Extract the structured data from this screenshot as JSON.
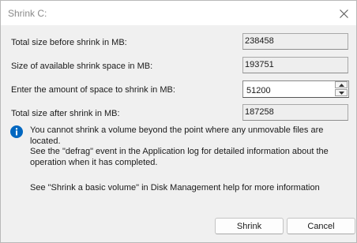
{
  "window": {
    "title": "Shrink C:"
  },
  "fields": {
    "total_before": {
      "label": "Total size before shrink in MB:",
      "value": "238458"
    },
    "available": {
      "label": "Size of available shrink space in MB:",
      "value": "193751"
    },
    "amount": {
      "label": "Enter the amount of space to shrink in MB:",
      "value": "51200"
    },
    "total_after": {
      "label": "Total size after shrink in MB:",
      "value": "187258"
    }
  },
  "info": {
    "line1": "You cannot shrink a volume beyond the point where any unmovable files are located.",
    "line2": "See the \"defrag\" event in the Application log for detailed information about the",
    "line3": "operation when it has completed.",
    "help": "See \"Shrink a basic volume\" in Disk Management help for more information"
  },
  "buttons": {
    "shrink": "Shrink",
    "cancel": "Cancel"
  },
  "icons": {
    "close": "close-icon",
    "info": "info-icon",
    "spin_up": "chevron-up-icon",
    "spin_down": "chevron-down-icon"
  },
  "colors": {
    "info_blue": "#0067c0",
    "title_text": "#8a8a8a"
  }
}
